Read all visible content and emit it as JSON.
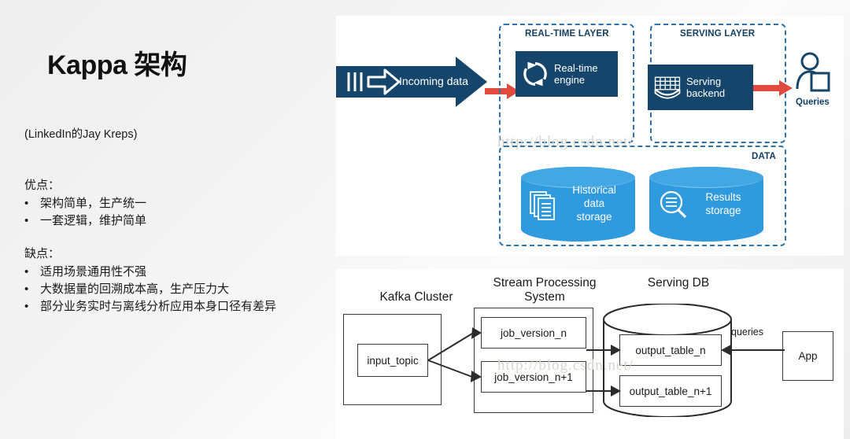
{
  "slide": {
    "title": "Kappa 架构",
    "subtitle": "(LinkedIn的Jay Kreps)",
    "sections": [
      {
        "heading": "优点：",
        "bullets": [
          {
            "marker": "•",
            "text": "架构简单，生产统一"
          },
          {
            "marker": "•",
            "text": "一套逻辑，维护简单"
          }
        ]
      },
      {
        "heading": "缺点：",
        "bullets": [
          {
            "marker": "•",
            "text": "适用场景通用性不强"
          },
          {
            "marker": "•",
            "text": "大数据量的回溯成本高，生产压力大"
          },
          {
            "marker": "•",
            "text": "部分业务实时与离线分析应用本身口径有差异"
          }
        ]
      }
    ]
  },
  "watermark": "http://blog.csdn.net/",
  "diagram_top": {
    "incoming": {
      "label": "Incoming data",
      "icon": "incoming-data-arrow-icon"
    },
    "layers": [
      {
        "label": "REAL-TIME LAYER"
      },
      {
        "label": "SERVING LAYER"
      },
      {
        "label": "DATA"
      }
    ],
    "nodes": [
      {
        "label": "Real-time engine",
        "line1": "Real-time",
        "line2": "engine",
        "icon": "refresh-cycle-icon"
      },
      {
        "label": "Serving backend",
        "line1": "Serving",
        "line2": "backend",
        "icon": "grid-table-icon"
      }
    ],
    "stores": [
      {
        "line1": "Historical",
        "line2": "data",
        "line3": "storage",
        "icon": "documents-stack-icon"
      },
      {
        "line1": "Results",
        "line2": "storage",
        "icon": "search-list-icon"
      }
    ],
    "consumer": {
      "label": "Queries",
      "icon": "person-query-icon"
    },
    "colors": {
      "navy": "#16456c",
      "dashed_border": "#2f73ad",
      "red_arrow": "#e04a3f",
      "cylinder": "#2f9ade",
      "label_navy": "#123f63"
    }
  },
  "diagram_bottom": {
    "groups": [
      {
        "label": "Kafka Cluster"
      },
      {
        "label": "Stream Processing System",
        "line1": "Stream Processing",
        "line2": "System"
      },
      {
        "label": "Serving DB"
      }
    ],
    "nodes": [
      {
        "label": "input_topic"
      },
      {
        "label": "job_version_n"
      },
      {
        "label": "job_version_n+1"
      },
      {
        "label": "output_table_n"
      },
      {
        "label": "output_table_n+1"
      },
      {
        "label": "App"
      }
    ],
    "edge_labels": [
      {
        "label": "queries"
      }
    ]
  }
}
